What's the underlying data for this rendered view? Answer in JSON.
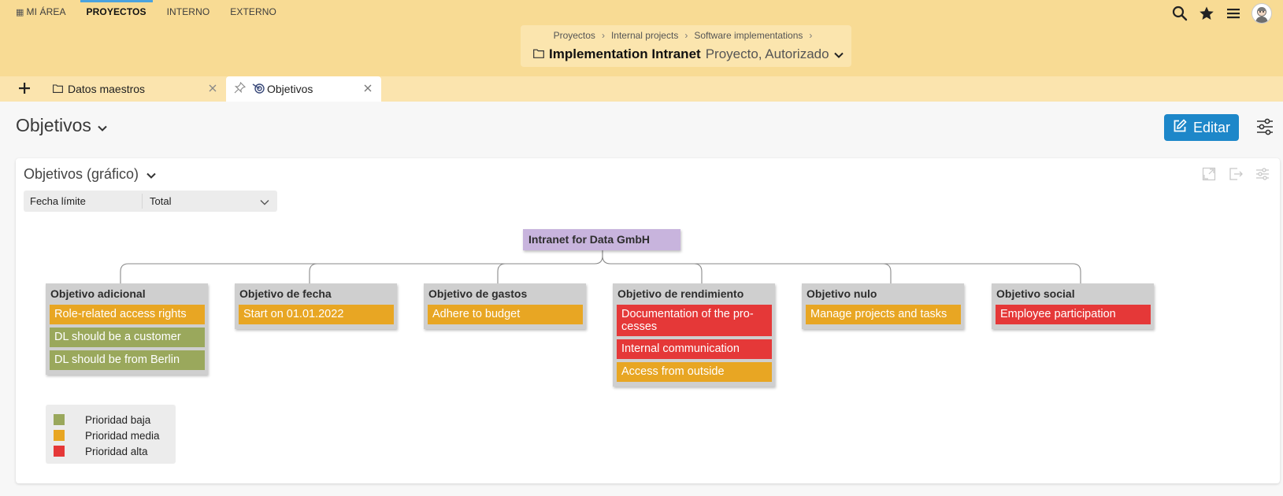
{
  "nav": {
    "items": [
      {
        "label": "MI ÁREA"
      },
      {
        "label": "PROYECTOS"
      },
      {
        "label": "INTERNO"
      },
      {
        "label": "EXTERNO"
      }
    ]
  },
  "header": {
    "breadcrumbs": [
      "Proyectos",
      "Internal projects",
      "Software implementations"
    ],
    "project_name": "Implementation Intranet",
    "project_status": "Proyecto, Autorizado"
  },
  "tabs": [
    {
      "label": "Datos maestros",
      "icon": "folder-icon"
    },
    {
      "label": "Objetivos",
      "icon": "target-icon"
    }
  ],
  "page": {
    "title": "Objetivos",
    "edit_label": "Editar"
  },
  "card": {
    "title": "Objetivos (gráfico)",
    "filter_label": "Fecha límite",
    "filter_value": "Total"
  },
  "colors": {
    "baja": "#9aa85c",
    "media": "#e8a623",
    "alta": "#e53838",
    "root": "#c8b4dd",
    "accent": "#1d87c9",
    "header": "#f8db94"
  },
  "orgchart": {
    "root": "Intranet for Data GmbH",
    "categories": [
      {
        "title": "Objetivo adicional",
        "goals": [
          {
            "text": "Role-related access rights",
            "priority": "media"
          },
          {
            "text": "DL should be a customer",
            "priority": "baja"
          },
          {
            "text": "DL should be from Berlin",
            "priority": "baja"
          }
        ]
      },
      {
        "title": "Objetivo de fecha",
        "goals": [
          {
            "text": "Start on 01.01.2022",
            "priority": "media"
          }
        ]
      },
      {
        "title": "Objetivo de gastos",
        "goals": [
          {
            "text": "Adhere to budget",
            "priority": "media"
          }
        ]
      },
      {
        "title": "Objetivo de rendimiento",
        "goals": [
          {
            "text": "Documentation of the pro-cesses",
            "priority": "alta"
          },
          {
            "text": "Internal communication",
            "priority": "alta"
          },
          {
            "text": "Access from outside",
            "priority": "media"
          }
        ]
      },
      {
        "title": "Objetivo nulo",
        "goals": [
          {
            "text": "Manage projects and tasks",
            "priority": "media"
          }
        ]
      },
      {
        "title": "Objetivo social",
        "goals": [
          {
            "text": "Employee participation",
            "priority": "alta"
          }
        ]
      }
    ]
  },
  "legend": [
    {
      "label": "Prioridad baja",
      "priority": "baja"
    },
    {
      "label": "Prioridad media",
      "priority": "media"
    },
    {
      "label": "Prioridad alta",
      "priority": "alta"
    }
  ]
}
